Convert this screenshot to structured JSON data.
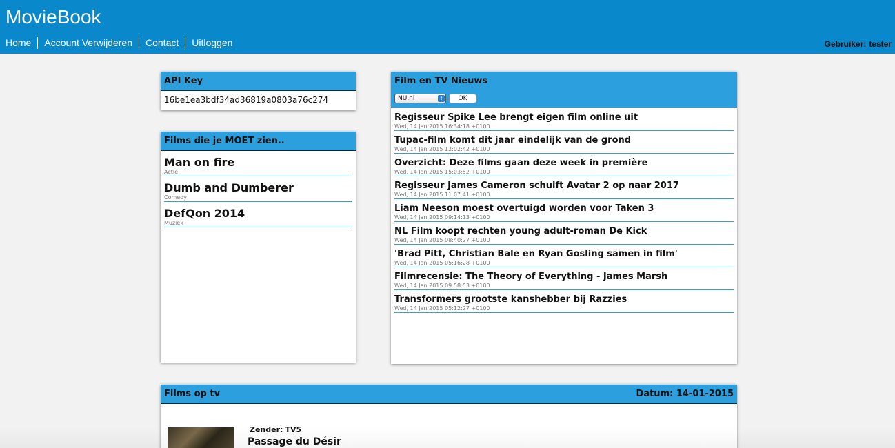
{
  "header": {
    "brand": "MovieBook",
    "nav": [
      "Home",
      "Account Verwijderen",
      "Contact",
      "Uitloggen"
    ],
    "user_label": "Gebruiker:",
    "user_name": "tester"
  },
  "api": {
    "title": "API Key",
    "key": "16be1ea3bdf34ad36819a0803a76c274"
  },
  "films": {
    "title": "Films die je MOET zien..",
    "items": [
      {
        "title": "Man on fire",
        "genre": "Actie"
      },
      {
        "title": "Dumb and Dumberer",
        "genre": "Comedy"
      },
      {
        "title": "DefQon 2014",
        "genre": "Muziek"
      }
    ]
  },
  "news": {
    "title": "Film en TV Nieuws",
    "source": "NU.nl",
    "ok_label": "OK",
    "items": [
      {
        "title": "Regisseur Spike Lee brengt eigen film online uit",
        "date": "Wed, 14 Jan 2015 16:34:18 +0100"
      },
      {
        "title": "Tupac-film komt dit jaar eindelijk van de grond",
        "date": "Wed, 14 Jan 2015 12:02:42 +0100"
      },
      {
        "title": "Overzicht: Deze films gaan deze week in première",
        "date": "Wed, 14 Jan 2015 15:03:52 +0100"
      },
      {
        "title": "Regisseur James Cameron schuift Avatar 2 op naar 2017",
        "date": "Wed, 14 Jan 2015 11:07:41 +0100"
      },
      {
        "title": "Liam Neeson moest overtuigd worden voor Taken 3",
        "date": "Wed, 14 Jan 2015 09:14:13 +0100"
      },
      {
        "title": "NL Film koopt rechten young adult-roman De Kick",
        "date": "Wed, 14 Jan 2015 08:40:27 +0100"
      },
      {
        "title": "'Brad Pitt, Christian Bale en Ryan Gosling samen in film'",
        "date": "Wed, 14 Jan 2015 05:16:28 +0100"
      },
      {
        "title": "Filmrecensie: The Theory of Everything - James Marsh",
        "date": "Wed, 14 Jan 2015 09:58:53 +0100"
      },
      {
        "title": "Transformers grootste kanshebber bij Razzies",
        "date": "Wed, 14 Jan 2015 05:12:27 +0100"
      }
    ]
  },
  "tv": {
    "title": "Films op tv",
    "date": "Datum: 14-01-2015",
    "channel_label": "Zender:",
    "channel": "TV5",
    "show": "Passage du Désir"
  },
  "colors": {
    "header": "#0a88cc",
    "panel_head": "#2ca0de"
  }
}
